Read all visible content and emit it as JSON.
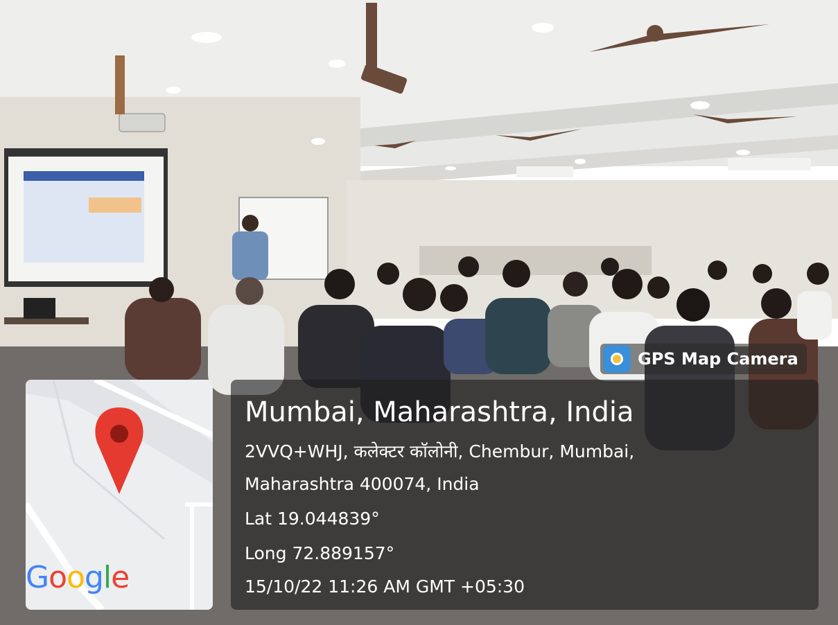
{
  "photo": {
    "scene": "lecture-hall-with-audience",
    "colors": {
      "ceiling": "#e7e8e6",
      "wall": "#e4e1da",
      "floor": "#6e6b68",
      "screen": "#ffffff"
    }
  },
  "overlay": {
    "app_badge": {
      "icon": "gps-map-camera-icon",
      "label": "GPS Map Camera"
    },
    "location": {
      "city": "Mumbai, Maharashtra, India",
      "address_line1": "2VVQ+WHJ, कलेक्टर कॉलोनी, Chembur, Mumbai,",
      "address_line2": "Maharashtra 400074, India",
      "latitude": "Lat 19.044839°",
      "longitude": "Long 72.889157°",
      "datetime": "15/10/22 11:26 AM GMT +05:30"
    },
    "map": {
      "logo": [
        "G",
        "o",
        "o",
        "g",
        "l",
        "e"
      ],
      "logo_colors": [
        "#4285F4",
        "#EA4335",
        "#FBBC05",
        "#4285F4",
        "#34A853",
        "#EA4335"
      ],
      "pin_color": "#e53a2f"
    }
  }
}
